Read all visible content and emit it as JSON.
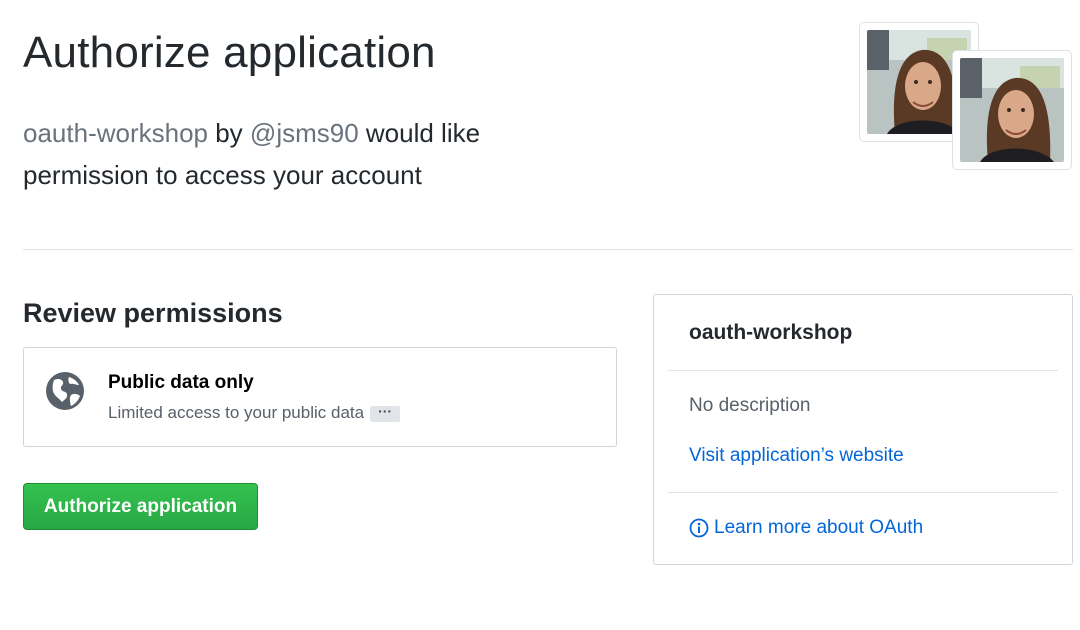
{
  "header": {
    "title": "Authorize application",
    "app_name": "oauth-workshop",
    "by_text": " by ",
    "owner": "@jsms90",
    "request_text": " would like permission to access your account"
  },
  "avatars": {
    "icon": "user-avatar-photo"
  },
  "permissions": {
    "heading": "Review permissions",
    "items": [
      {
        "icon": "globe-icon",
        "title": "Public data only",
        "description": "Limited access to your public data",
        "more_label": "···"
      }
    ]
  },
  "actions": {
    "authorize_label": "Authorize application",
    "authorize_color": "#28a745"
  },
  "app_card": {
    "name": "oauth-workshop",
    "description": "No description",
    "website_link": "Visit application’s website",
    "learn_more": "Learn more about OAuth",
    "link_color": "#0366d6"
  }
}
